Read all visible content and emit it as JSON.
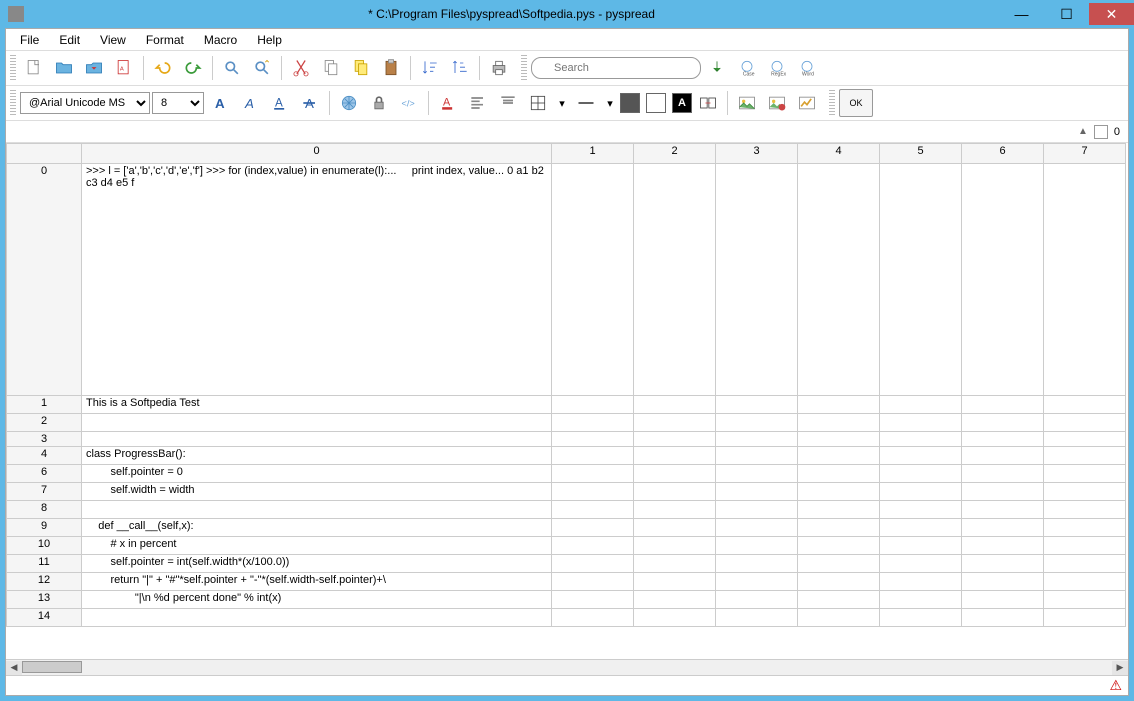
{
  "title": "* C:\\Program Files\\pyspread\\Softpedia.pys - pyspread",
  "menu": [
    "File",
    "Edit",
    "View",
    "Format",
    "Macro",
    "Help"
  ],
  "search_placeholder": "Search",
  "font_name": "@Arial Unicode MS",
  "font_size": "8",
  "page_number": "0",
  "ok_label": "OK",
  "columns": [
    "0",
    "1",
    "2",
    "3",
    "4",
    "5",
    "6",
    "7"
  ],
  "rows": [
    {
      "hdr": "0",
      "cls": "row0",
      "cells": [
        ">>> l = ['a','b','c','d','e','f'] >>> for (index,value) in enumerate(l):...     print index, value... 0 a1 b2 c3 d4 e5 f",
        "",
        "",
        "",
        "",
        "",
        "",
        ""
      ]
    },
    {
      "hdr": "1",
      "cls": "rowstd",
      "cells": [
        "This is a Softpedia Test",
        "",
        "",
        "",
        "",
        "",
        "",
        ""
      ]
    },
    {
      "hdr": "2",
      "cls": "rowstd",
      "cells": [
        "",
        "",
        "",
        "",
        "",
        "",
        "",
        ""
      ]
    },
    {
      "hdr": "3",
      "cls": "rowstd",
      "cells": [
        "",
        "",
        "",
        "",
        "",
        "",
        "",
        ""
      ],
      "short": true
    },
    {
      "hdr": "4",
      "cls": "rowstd",
      "cells": [
        "class ProgressBar():",
        "",
        "",
        "",
        "",
        "",
        "",
        ""
      ]
    },
    {
      "hdr": "6",
      "cls": "rowstd",
      "cells": [
        "        self.pointer = 0",
        "",
        "",
        "",
        "",
        "",
        "",
        ""
      ]
    },
    {
      "hdr": "7",
      "cls": "rowstd",
      "cells": [
        "        self.width = width",
        "",
        "",
        "",
        "",
        "",
        "",
        ""
      ]
    },
    {
      "hdr": "8",
      "cls": "rowstd",
      "cells": [
        "",
        "",
        "",
        "",
        "",
        "",
        "",
        ""
      ]
    },
    {
      "hdr": "9",
      "cls": "rowstd",
      "cells": [
        "    def __call__(self,x):",
        "",
        "",
        "",
        "",
        "",
        "",
        ""
      ]
    },
    {
      "hdr": "10",
      "cls": "rowstd",
      "cells": [
        "        # x in percent",
        "",
        "",
        "",
        "",
        "",
        "",
        ""
      ]
    },
    {
      "hdr": "11",
      "cls": "rowstd",
      "cells": [
        "        self.pointer = int(self.width*(x/100.0))",
        "",
        "",
        "",
        "",
        "",
        "",
        ""
      ]
    },
    {
      "hdr": "12",
      "cls": "rowstd",
      "cells": [
        "        return \"|\" + \"#\"*self.pointer + \"-\"*(self.width-self.pointer)+\\",
        "",
        "",
        "",
        "",
        "",
        "",
        ""
      ]
    },
    {
      "hdr": "13",
      "cls": "rowstd",
      "cells": [
        "                \"|\\n %d percent done\" % int(x)",
        "",
        "",
        "",
        "",
        "",
        "",
        ""
      ]
    },
    {
      "hdr": "14",
      "cls": "rowstd",
      "cells": [
        "",
        "",
        "",
        "",
        "",
        "",
        "",
        ""
      ]
    }
  ],
  "icons": {
    "case": "Case",
    "regex": "RegEx",
    "word": "Word"
  }
}
